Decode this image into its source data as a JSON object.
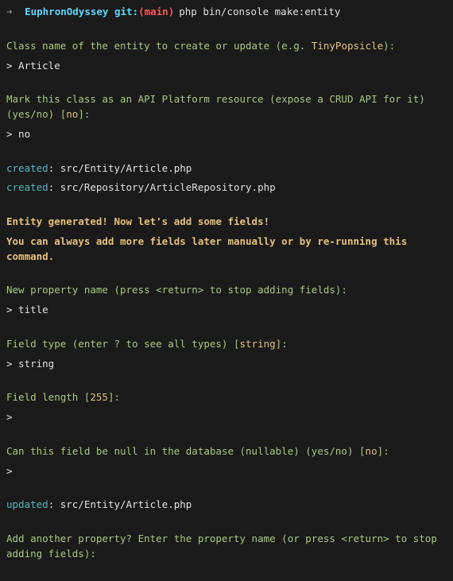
{
  "prompt": {
    "arrow": "➜",
    "dir": "EuphronOdyssey",
    "git_label": "git:",
    "paren_open": "(",
    "branch": "main",
    "paren_close": ")",
    "command": "php bin/console make:entity"
  },
  "q1": {
    "prefix": "Class name of the entity to create or update (e.g. ",
    "example": "TinyPopsicle",
    "suffix": "):",
    "answer": "> Article"
  },
  "q2": {
    "prefix": "Mark this class as an API Platform resource (expose a CRUD API for it) (yes/no) [",
    "default": "no",
    "suffix": "]:",
    "answer": "> no"
  },
  "created1": {
    "label": "created",
    "path": ": src/Entity/Article.php"
  },
  "created2": {
    "label": "created",
    "path": ": src/Repository/ArticleRepository.php"
  },
  "msg1": "Entity generated! Now let's add some fields!",
  "msg2": "You can always add more fields later manually or by re-running this command.",
  "q3": {
    "text": "New property name (press <return> to stop adding fields):",
    "answer": "> title"
  },
  "q4": {
    "prefix": "Field type (enter ? to see all types) [",
    "default": "string",
    "suffix": "]:",
    "answer": "> string"
  },
  "q5": {
    "prefix": "Field length [",
    "default": "255",
    "suffix": "]:",
    "answer": ">"
  },
  "q6": {
    "prefix": "Can this field be null in the database (nullable) (yes/no) [",
    "default": "no",
    "suffix": "]:",
    "answer": ">"
  },
  "updated": {
    "label": "updated",
    "path": ": src/Entity/Article.php"
  },
  "q7": {
    "text": "Add another property? Enter the property name (or press <return> to stop adding fields):"
  }
}
